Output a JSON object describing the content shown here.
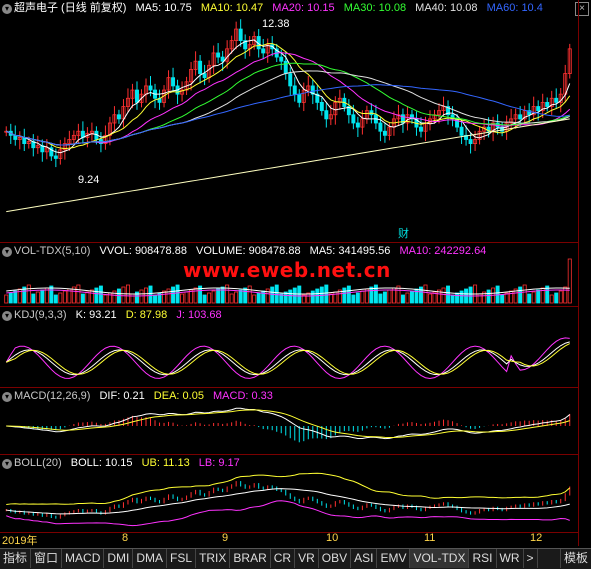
{
  "header": {
    "title": "超声电子 (日线 前复权)",
    "ma": [
      {
        "label": "MA5: 10.75",
        "color": "#ffffff"
      },
      {
        "label": "MA10: 10.47",
        "color": "#ffff33"
      },
      {
        "label": "MA20: 10.15",
        "color": "#ff33ff"
      },
      {
        "label": "MA30: 10.08",
        "color": "#33ff33"
      },
      {
        "label": "MA40: 10.08",
        "color": "#e0e0e0"
      },
      {
        "label": "MA60: 10.4",
        "color": "#3366ff"
      }
    ]
  },
  "annotations": {
    "high": "12.38",
    "low": "9.24",
    "cai": "财"
  },
  "vol": {
    "name": "VOL-TDX(5,10)",
    "vvol": "VVOL: 908478.88",
    "volume": "VOLUME: 908478.88",
    "ma5": "MA5: 341495.56",
    "ma10": "MA10: 242292.64"
  },
  "kdj": {
    "name": "KDJ(9,3,3)",
    "k": "K: 93.21",
    "d": "D: 87.98",
    "j": "J: 103.68"
  },
  "macd": {
    "name": "MACD(12,26,9)",
    "dif": "DIF: 0.21",
    "dea": "DEA: 0.05",
    "macd": "MACD: 0.33"
  },
  "boll": {
    "name": "BOLL(20)",
    "boll": "BOLL: 10.15",
    "ub": "UB: 11.13",
    "lb": "LB: 9.17"
  },
  "watermark": "www.eweb.net.cn",
  "dates": [
    "2019年",
    "8",
    "9",
    "10",
    "11",
    "12"
  ],
  "tabs": [
    "指标",
    "窗口",
    "MACD",
    "DMI",
    "DMA",
    "FSL",
    "TRIX",
    "BRAR",
    "CR",
    "VR",
    "OBV",
    "ASI",
    "EMV",
    "VOL-TDX",
    "RSI",
    "WR",
    ">",
    "模板"
  ],
  "chart_data": {
    "type": "candlestick",
    "series": "超声电子 daily price (approx)",
    "close": [
      9.9,
      9.8,
      9.7,
      9.75,
      9.6,
      9.65,
      9.5,
      9.55,
      9.4,
      9.5,
      9.3,
      9.24,
      9.45,
      9.6,
      9.7,
      9.8,
      9.9,
      9.75,
      9.85,
      9.9,
      9.7,
      9.6,
      9.8,
      10.1,
      10.3,
      10.2,
      10.5,
      10.7,
      10.9,
      10.6,
      10.8,
      11.0,
      10.9,
      10.7,
      10.6,
      10.9,
      11.2,
      11.0,
      10.8,
      10.9,
      11.1,
      11.4,
      11.6,
      11.3,
      11.2,
      11.5,
      11.8,
      11.7,
      11.6,
      11.9,
      12.1,
      12.38,
      12.1,
      11.9,
      12.0,
      12.2,
      11.9,
      11.8,
      12.0,
      11.9,
      11.7,
      11.6,
      11.3,
      11.0,
      10.8,
      10.6,
      10.9,
      11.0,
      10.8,
      10.6,
      10.4,
      10.2,
      10.3,
      10.6,
      10.7,
      10.5,
      10.3,
      10.1,
      10.0,
      10.2,
      10.4,
      10.3,
      10.1,
      9.9,
      9.8,
      10.0,
      10.2,
      10.3,
      10.1,
      10.3,
      10.2,
      10.0,
      9.9,
      10.1,
      10.2,
      10.3,
      10.4,
      10.5,
      10.3,
      10.2,
      10.0,
      9.8,
      9.7,
      9.6,
      9.7,
      9.9,
      10.0,
      9.9,
      10.1,
      10.0,
      9.9,
      10.1,
      10.2,
      10.3,
      10.2,
      10.4,
      10.3,
      10.5,
      10.4,
      10.6,
      10.5,
      10.7,
      10.6,
      10.8,
      11.3,
      11.9
    ]
  }
}
